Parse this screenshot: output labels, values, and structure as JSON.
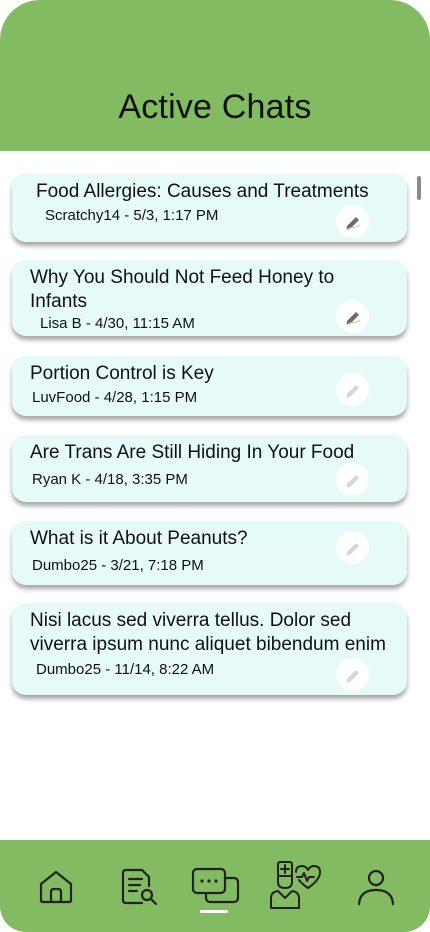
{
  "header": {
    "title": "Active Chats"
  },
  "chats": [
    {
      "title": "Food Allergies: Causes and Treatments",
      "meta": "Scratchy14 - 5/3, 1:17 PM"
    },
    {
      "title": "Why You Should Not Feed Honey to Infants",
      "meta": "Lisa B - 4/30, 11:15 AM"
    },
    {
      "title": "Portion Control is Key",
      "meta": "LuvFood - 4/28, 1:15 PM"
    },
    {
      "title": "Are Trans Are Still Hiding In Your Food",
      "meta": "Ryan K - 4/18, 3:35 PM"
    },
    {
      "title": "What is it About Peanuts?",
      "meta": "Dumbo25 - 3/21, 7:18 PM"
    },
    {
      "title": "Nisi lacus sed viverra tellus. Dolor sed viverra ipsum nunc aliquet bibendum enim",
      "meta": "Dumbo25 - 11/14, 8:22 AM"
    }
  ],
  "nav": {
    "items": [
      {
        "icon": "home-icon"
      },
      {
        "icon": "document-search-icon"
      },
      {
        "icon": "chat-bubbles-icon",
        "active": true
      },
      {
        "icon": "doctor-heart-icon"
      },
      {
        "icon": "profile-icon"
      }
    ]
  },
  "colors": {
    "header": "#83bb62",
    "card": "#e6fbf7",
    "nav": "#83bb62"
  }
}
